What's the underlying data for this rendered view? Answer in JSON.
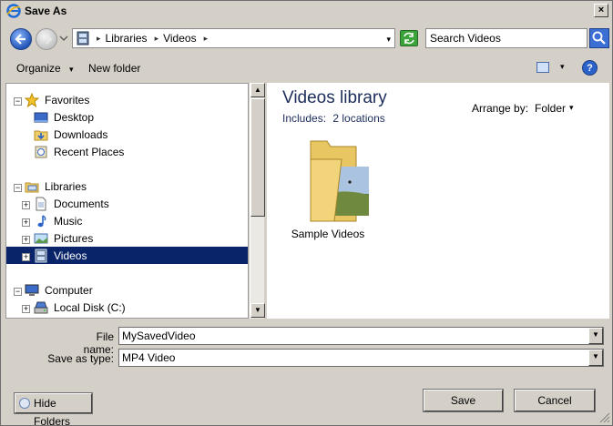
{
  "window": {
    "title": "Save As",
    "close_glyph": "×"
  },
  "address_bar": {
    "breadcrumbs": [
      "Libraries",
      "Videos"
    ],
    "separator": "▸",
    "dropdown_glyph": "▾",
    "search_placeholder": "Search Videos"
  },
  "toolbar": {
    "organize_label": "Organize",
    "new_folder_label": "New folder",
    "dropdown_glyph": "▾",
    "help_glyph": "?"
  },
  "tree": {
    "favorites": "Favorites",
    "desktop": "Desktop",
    "downloads": "Downloads",
    "recent_places": "Recent Places",
    "libraries": "Libraries",
    "documents": "Documents",
    "music": "Music",
    "pictures": "Pictures",
    "videos": "Videos",
    "computer": "Computer",
    "local_disk": "Local Disk (C:)",
    "expand_glyph": "+",
    "collapse_glyph": "−"
  },
  "scrollbar": {
    "up_glyph": "▲",
    "down_glyph": "▼"
  },
  "content": {
    "title": "Videos library",
    "includes_label": "Includes:",
    "includes_link": "2 locations",
    "arrange_label": "Arrange by:",
    "arrange_value": "Folder",
    "arrange_glyph": "▾",
    "items": [
      {
        "label": "Sample Videos",
        "icon": "folder-with-video-thumbnail-icon"
      }
    ]
  },
  "form": {
    "filename_label": "File name:",
    "filename_value": "MySavedVideo",
    "savetype_label": "Save as type:",
    "savetype_value": "MP4 Video",
    "combo_glyph": "▼"
  },
  "buttons": {
    "hide_folders": "Hide Folders",
    "save": "Save",
    "cancel": "Cancel"
  },
  "colors": {
    "selection": "#0a246a",
    "window_bg": "#d4d0c8",
    "library_title": "#1c2d5a"
  }
}
